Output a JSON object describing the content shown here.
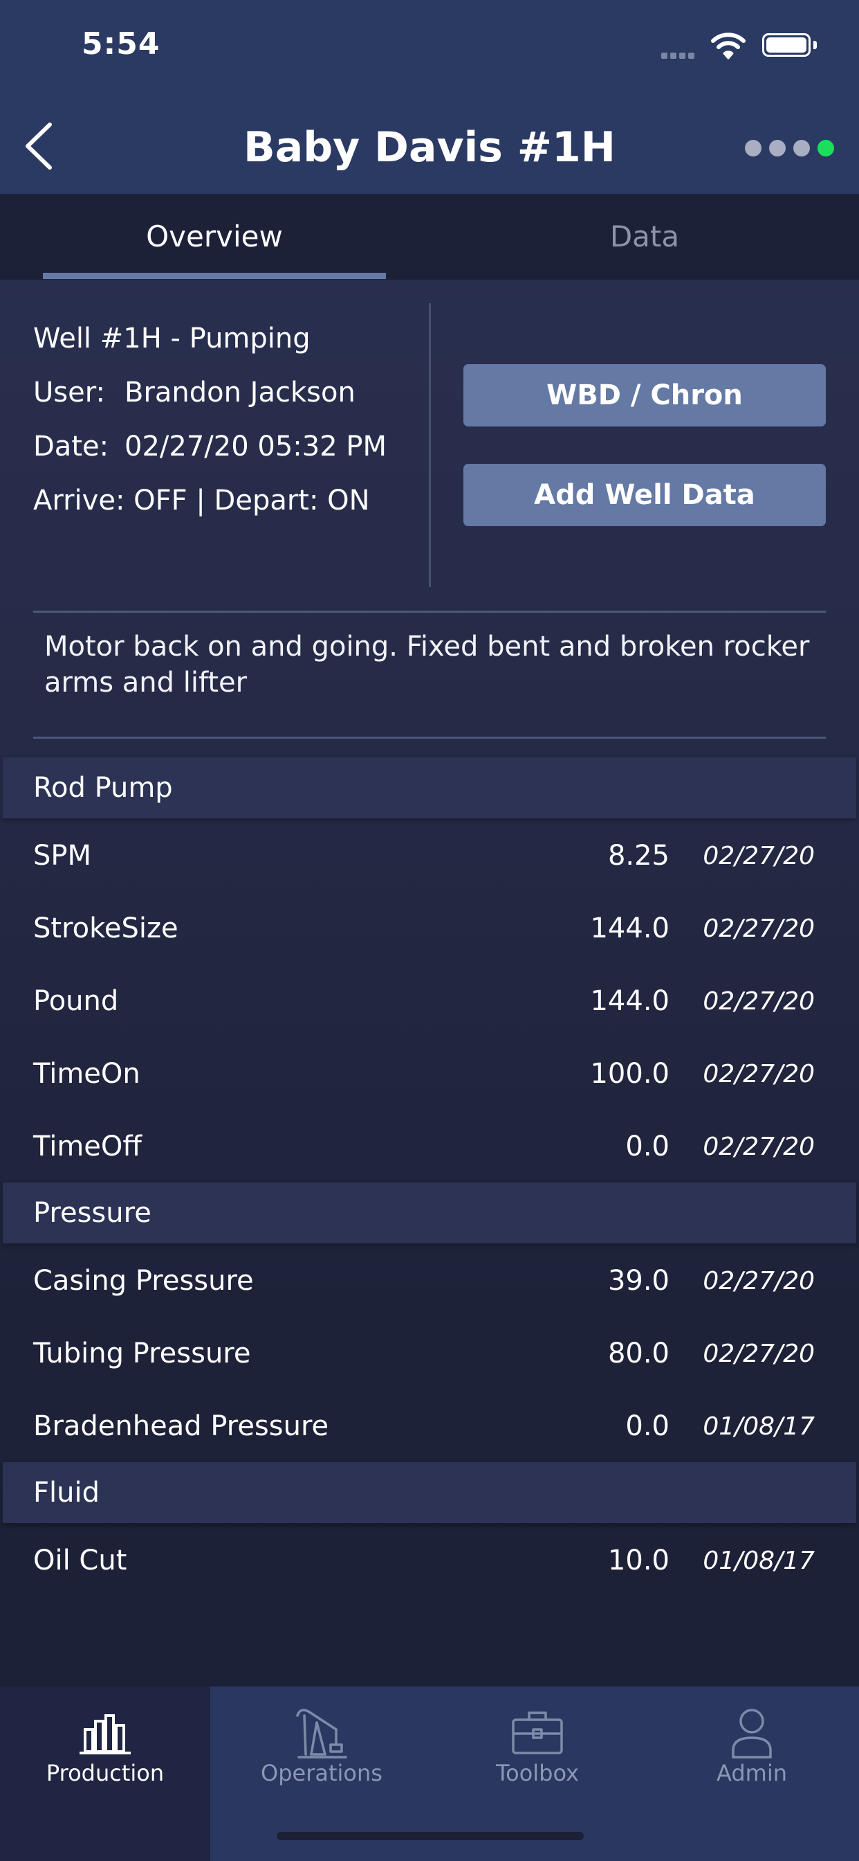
{
  "status_bar": {
    "time": "5:54"
  },
  "header": {
    "title": "Baby Davis #1H",
    "page_dots": 4,
    "active_dot": 4,
    "active_dot_color": "#19e05a"
  },
  "tabs": [
    {
      "label": "Overview",
      "active": true
    },
    {
      "label": "Data",
      "active": false
    }
  ],
  "well": {
    "status": "Well #1H - Pumping",
    "user_label": "User:",
    "user": "Brandon Jackson",
    "date_label": "Date:",
    "date": "02/27/20 05:32 PM",
    "arrive_depart": "Arrive: OFF | Depart: ON"
  },
  "actions": {
    "wbd_chron": "WBD / Chron",
    "add_well_data": "Add Well Data"
  },
  "note": "Motor back on and going. Fixed bent and broken rocker arms and lifter",
  "sections": [
    {
      "title": "Rod Pump",
      "rows": [
        {
          "name": "SPM",
          "value": "8.25",
          "date": "02/27/20"
        },
        {
          "name": "StrokeSize",
          "value": "144.0",
          "date": "02/27/20"
        },
        {
          "name": "Pound",
          "value": "144.0",
          "date": "02/27/20"
        },
        {
          "name": "TimeOn",
          "value": "100.0",
          "date": "02/27/20"
        },
        {
          "name": "TimeOff",
          "value": "0.0",
          "date": "02/27/20"
        }
      ]
    },
    {
      "title": "Pressure",
      "rows": [
        {
          "name": "Casing Pressure",
          "value": "39.0",
          "date": "02/27/20"
        },
        {
          "name": "Tubing Pressure",
          "value": "80.0",
          "date": "02/27/20"
        },
        {
          "name": "Bradenhead Pressure",
          "value": "0.0",
          "date": "01/08/17"
        }
      ]
    },
    {
      "title": "Fluid",
      "rows": [
        {
          "name": "Oil Cut",
          "value": "10.0",
          "date": "01/08/17"
        }
      ]
    }
  ],
  "tabbar": [
    {
      "label": "Production",
      "icon": "bar-chart-icon",
      "active": true
    },
    {
      "label": "Operations",
      "icon": "pumpjack-icon",
      "active": false
    },
    {
      "label": "Toolbox",
      "icon": "toolbox-icon",
      "active": false
    },
    {
      "label": "Admin",
      "icon": "person-icon",
      "active": false
    }
  ],
  "colors": {
    "active_tab_text": "#ffffff",
    "inactive_tab_text": "#8d93a8",
    "button_bg": "#6479a3"
  }
}
